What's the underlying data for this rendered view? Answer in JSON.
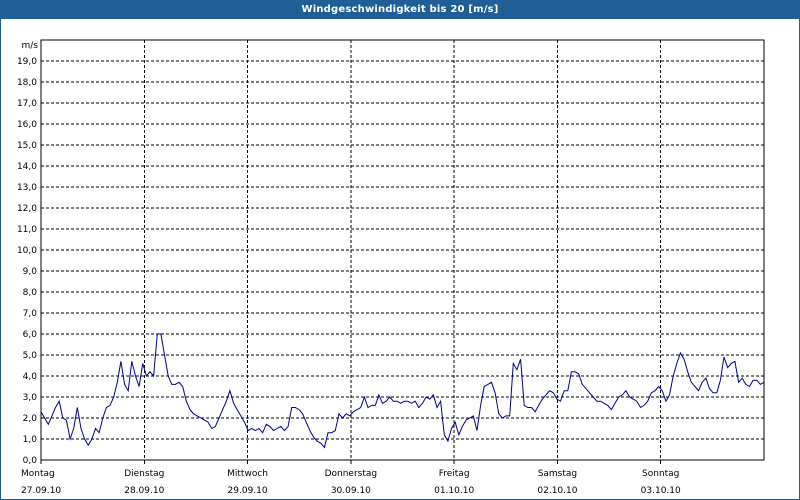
{
  "window": {
    "title": "Windgeschwindigkeit bis 20 [m/s]"
  },
  "colors": {
    "titlebar": "#1f5e96",
    "series": "#00008b",
    "grid": "#000000"
  },
  "chart_data": {
    "type": "line",
    "title": "Windgeschwindigkeit bis 20 [m/s]",
    "ylabel": "m/s",
    "ylim": [
      0,
      20
    ],
    "ytick_labels": [
      "0,0",
      "1,0",
      "2,0",
      "3,0",
      "4,0",
      "5,0",
      "6,0",
      "7,0",
      "8,0",
      "9,0",
      "10,0",
      "11,0",
      "12,0",
      "13,0",
      "14,0",
      "15,0",
      "16,0",
      "17,0",
      "18,0",
      "19,0"
    ],
    "x_axis": "hourly samples, Monday 27.09.10 to Sunday 03.10.10",
    "xlim": [
      0,
      168
    ],
    "grid": true,
    "x_ticks": [
      {
        "day": "Montag",
        "date": "27.09.10",
        "x": 0
      },
      {
        "day": "Dienstag",
        "date": "28.09.10",
        "x": 24
      },
      {
        "day": "Mittwoch",
        "date": "29.09.10",
        "x": 48
      },
      {
        "day": "Donnerstag",
        "date": "30.09.10",
        "x": 72
      },
      {
        "day": "Freitag",
        "date": "01.10.10",
        "x": 96
      },
      {
        "day": "Samstag",
        "date": "02.10.10",
        "x": 120
      },
      {
        "day": "Sonntag",
        "date": "03.10.10",
        "x": 144
      }
    ],
    "series": [
      {
        "values": [
          2.3,
          2.0,
          1.7,
          2.1,
          2.5,
          2.8,
          2.0,
          1.9,
          1.0,
          1.5,
          2.5,
          1.5,
          1.0,
          0.7,
          1.0,
          1.5,
          1.3,
          2.0,
          2.5,
          2.6,
          3.0,
          3.7,
          4.7,
          3.6,
          3.3,
          4.7,
          4.0,
          3.5,
          4.6,
          4.0,
          4.2,
          4.0,
          6.0,
          6.0,
          5.0,
          4.0,
          3.6,
          3.6,
          3.7,
          3.5,
          2.8,
          2.4,
          2.2,
          2.1,
          2.0,
          1.9,
          1.8,
          1.5,
          1.6,
          2.0,
          2.4,
          2.8,
          3.3,
          2.7,
          2.4,
          2.1,
          1.8,
          1.4,
          1.5,
          1.4,
          1.5,
          1.3,
          1.7,
          1.6,
          1.4,
          1.5,
          1.6,
          1.4,
          1.6,
          2.5,
          2.5,
          2.4,
          2.2,
          1.8,
          1.4,
          1.1,
          0.9,
          0.8,
          0.6,
          1.3,
          1.3,
          1.4,
          2.2,
          2.0,
          2.2,
          2.1,
          2.3,
          2.4,
          2.5,
          3.0,
          2.5,
          2.6,
          2.6,
          3.1,
          2.7,
          2.8,
          3.0,
          2.8,
          2.8,
          2.7,
          2.8,
          2.8,
          2.7,
          2.8,
          2.5,
          2.7,
          3.0,
          2.9,
          3.1,
          2.5,
          2.8,
          1.2,
          0.9,
          1.5,
          1.8,
          1.2,
          1.6,
          1.9,
          2.0,
          2.1,
          1.4,
          2.6,
          3.5,
          3.6,
          3.7,
          3.2,
          2.2,
          2.0,
          2.1,
          2.1,
          4.6,
          4.3,
          4.8,
          2.6,
          2.5,
          2.5,
          2.3,
          2.6,
          2.9,
          3.1,
          3.3,
          3.2,
          2.9,
          2.8,
          3.3,
          3.3,
          4.2,
          4.2,
          4.1,
          3.6,
          3.4,
          3.2,
          3.0,
          2.8,
          2.8,
          2.7,
          2.6,
          2.4,
          2.7,
          3.0,
          3.1,
          3.3,
          3.0,
          2.9,
          2.8,
          2.5,
          2.6,
          2.8,
          3.2,
          3.3,
          3.5,
          3.3,
          2.8,
          3.1,
          4.0,
          4.6,
          5.1,
          4.8,
          4.2,
          3.7,
          3.5,
          3.3,
          3.7,
          3.9,
          3.4,
          3.2,
          3.2,
          3.8,
          4.9,
          4.4,
          4.6,
          4.7,
          3.7,
          3.9,
          3.6,
          3.5,
          3.8,
          3.8,
          3.6,
          3.7
        ]
      }
    ]
  }
}
